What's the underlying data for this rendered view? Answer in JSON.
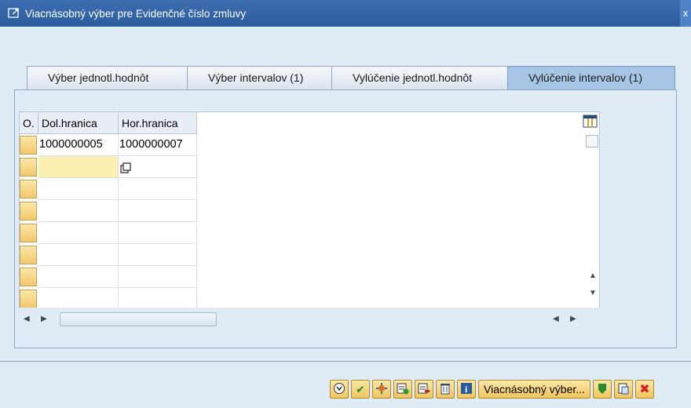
{
  "window": {
    "title": "Viacnásobný výber pre Evidenčné číslo zmluvy",
    "close_label": "x"
  },
  "tabs": [
    {
      "label": "Výber jednotl.hodnôt",
      "active": false
    },
    {
      "label": "Výber intervalov (1)",
      "active": false
    },
    {
      "label": "Vylúčenie jednotl.hodnôt",
      "active": false
    },
    {
      "label": "Vylúčenie intervalov (1)",
      "active": true
    }
  ],
  "grid": {
    "headers": {
      "option": "O.",
      "low": "Dol.hranica",
      "high": "Hor.hranica"
    },
    "rows": [
      {
        "low": "1000000005",
        "high": "1000000007"
      }
    ]
  },
  "toolbar": {
    "multi_select_label": "Viacnásobný výber..."
  },
  "icons": [
    "table-settings-icon",
    "scroll-up-icon",
    "scroll-down-icon",
    "scroll-left-icon",
    "scroll-right-icon",
    "copy-icon",
    "execute-icon",
    "check-icon",
    "select-icon",
    "insert-line-icon",
    "delete-line-icon",
    "trash-icon",
    "info-icon",
    "upload-icon",
    "clipboard-icon",
    "cancel-icon"
  ],
  "colors": {
    "title_bar": "#2b5c9e",
    "active_tab": "#a7c6e6",
    "button": "#f0c55f"
  }
}
